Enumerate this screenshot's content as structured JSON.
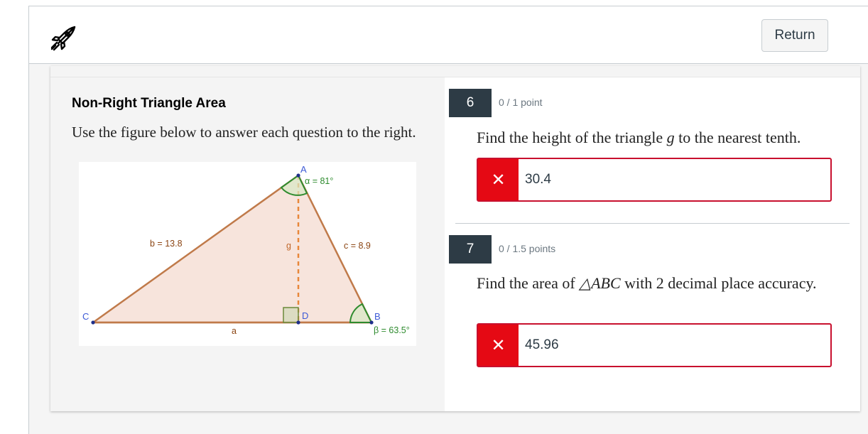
{
  "header": {
    "logo_icon": "rocket-icon",
    "return_label": "Return"
  },
  "left": {
    "title": "Non-Right Triangle Area",
    "instructions": "Use the figure below to answer each question to the right.",
    "figure": {
      "vertex_a": "A",
      "vertex_b": "B",
      "vertex_c": "C",
      "vertex_d": "D",
      "angle_alpha": "α = 81°",
      "angle_beta": "β = 63.5°",
      "side_b": "b = 13.8",
      "side_c": "c = 8.9",
      "side_a": "a",
      "height_g": "g"
    }
  },
  "questions": [
    {
      "number": "6",
      "points": "0 / 1 point",
      "text_before": "Find the height of the triangle ",
      "text_var": "g",
      "text_after": " to the nearest tenth.",
      "answer": "30.4",
      "status_icon": "close-icon"
    },
    {
      "number": "7",
      "points": "0 / 1.5 points",
      "text_before": "Find the area of ",
      "text_var": "△ABC",
      "text_after": " with 2 decimal place accuracy.",
      "answer": "45.96",
      "status_icon": "close-icon"
    }
  ],
  "colors": {
    "incorrect": "#e50914",
    "question_badge": "#2d3b45",
    "triangle_stroke": "#c07a4a",
    "triangle_fill": "#f7e4dc",
    "angle_green": "#2e8b2e",
    "vertex_blue": "#3d5ad6"
  }
}
